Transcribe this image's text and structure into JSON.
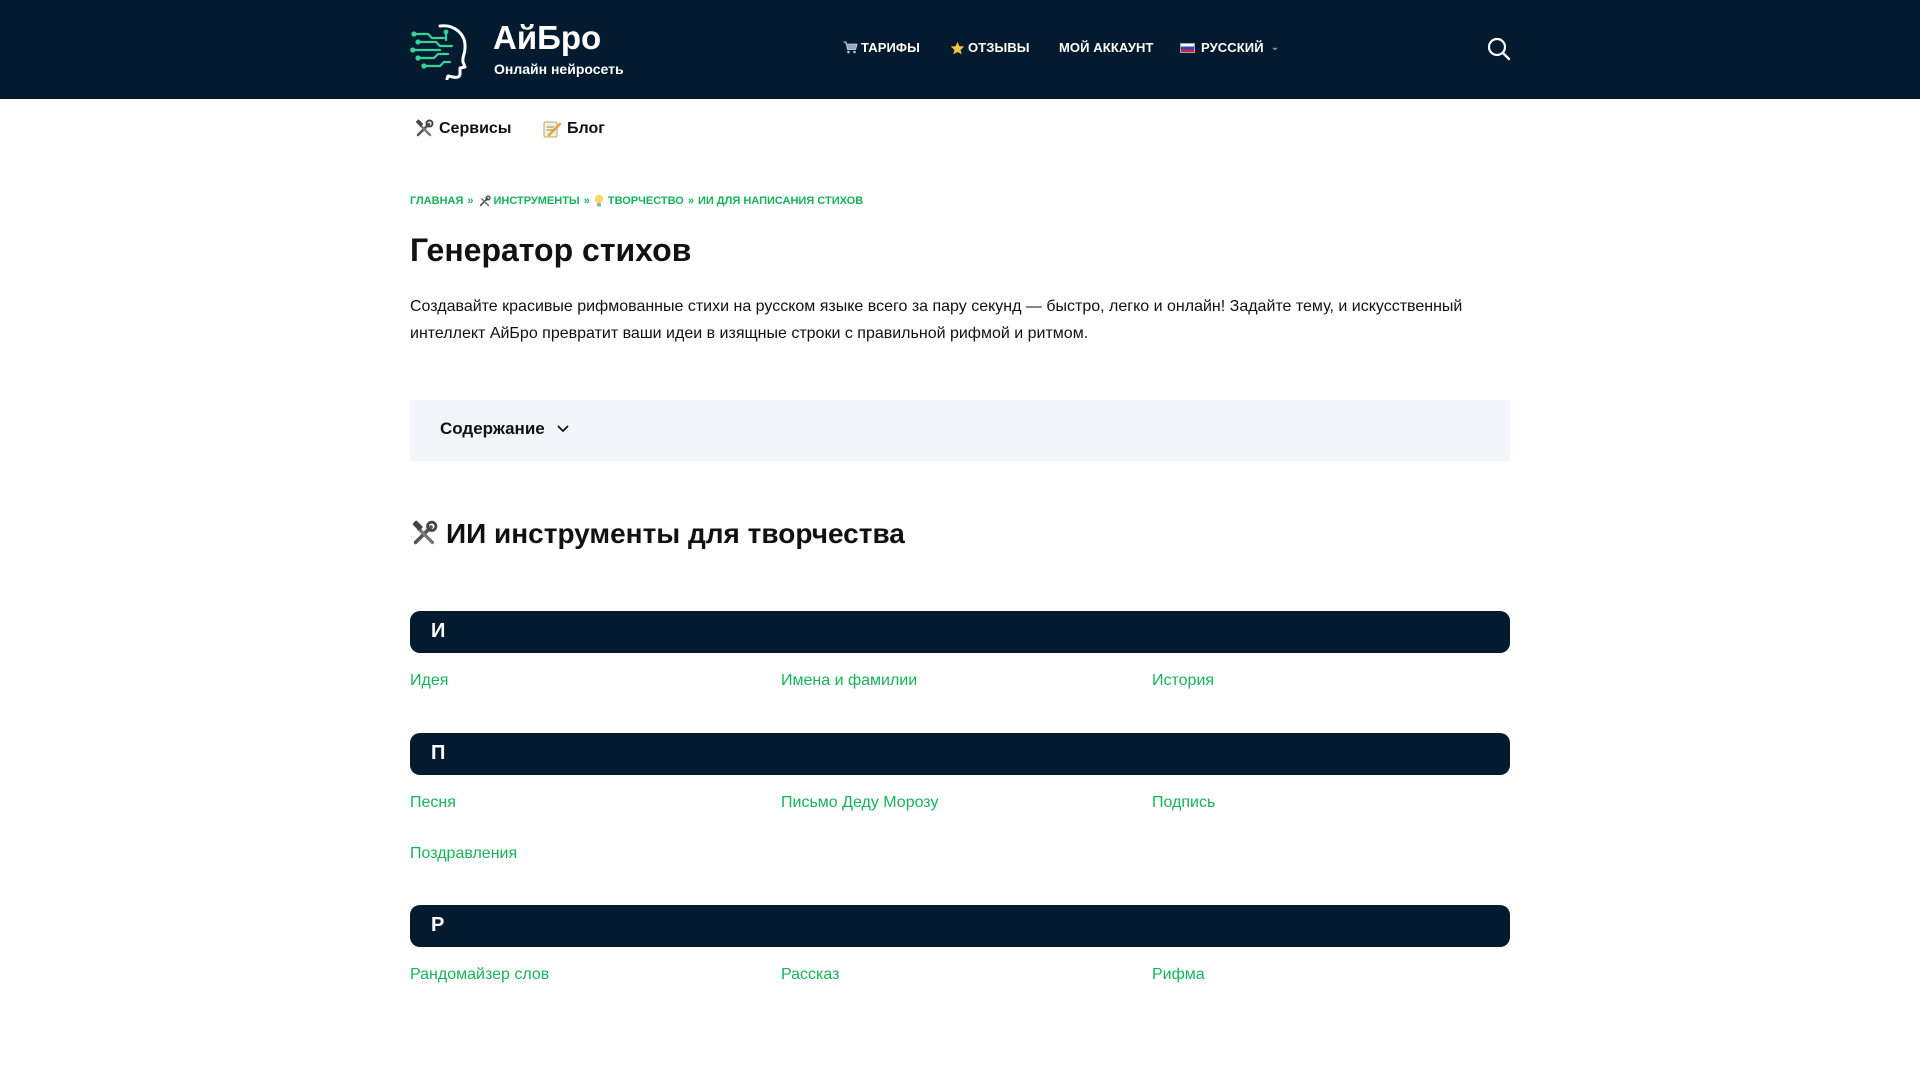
{
  "header": {
    "brand": "АйБро",
    "tagline": "Онлайн нейросеть",
    "nav": {
      "tariffs": "ТАРИФЫ",
      "reviews": "ОТЗЫВЫ",
      "account": "МОЙ АККАУНТ",
      "language": "РУССКИЙ"
    }
  },
  "subnav": {
    "services": "Сервисы",
    "blog": "Блог"
  },
  "breadcrumb": {
    "home": "ГЛАВНАЯ",
    "separator": "»",
    "tools": "ИНСТРУМЕНТЫ",
    "creativity": "ТВОРЧЕСТВО",
    "current": "ИИ ДЛЯ НАПИСАНИЯ СТИХОВ"
  },
  "page": {
    "title": "Генератор стихов",
    "lead": "Создавайте красивые рифмованные стихи на русском языке всего за пару секунд — быстро, легко и онлайн! Задайте тему, и искусственный интеллект АйБро превратит ваши идеи в изящные строки с правильной рифмой и ритмом."
  },
  "toc": {
    "label": "Содержание"
  },
  "section": {
    "title": "ИИ инструменты для творчества"
  },
  "groups": [
    {
      "letter": "И",
      "items": [
        "Идея",
        "Имена и фамилии",
        "История"
      ]
    },
    {
      "letter": "П",
      "items": [
        "Песня",
        "Письмо Деду Морозу",
        "Подпись",
        "Поздравления"
      ]
    },
    {
      "letter": "Р",
      "items": [
        "Рандомайзер слов",
        "Рассказ",
        "Рифма"
      ]
    }
  ],
  "colors": {
    "header_bg": "#041a2f",
    "accent_green": "#17b35a",
    "toc_bg": "#f2f5f9"
  },
  "icons": {
    "logo": "ai-head-circuit-logo",
    "tariffs": "shopping-cart-icon",
    "reviews": "star-icon",
    "language": "russia-flag-icon",
    "search": "search-icon",
    "services": "hammer-wrench-icon",
    "blog": "memo-pencil-icon",
    "creativity": "light-bulb-icon",
    "toc": "chevron-down-icon"
  }
}
